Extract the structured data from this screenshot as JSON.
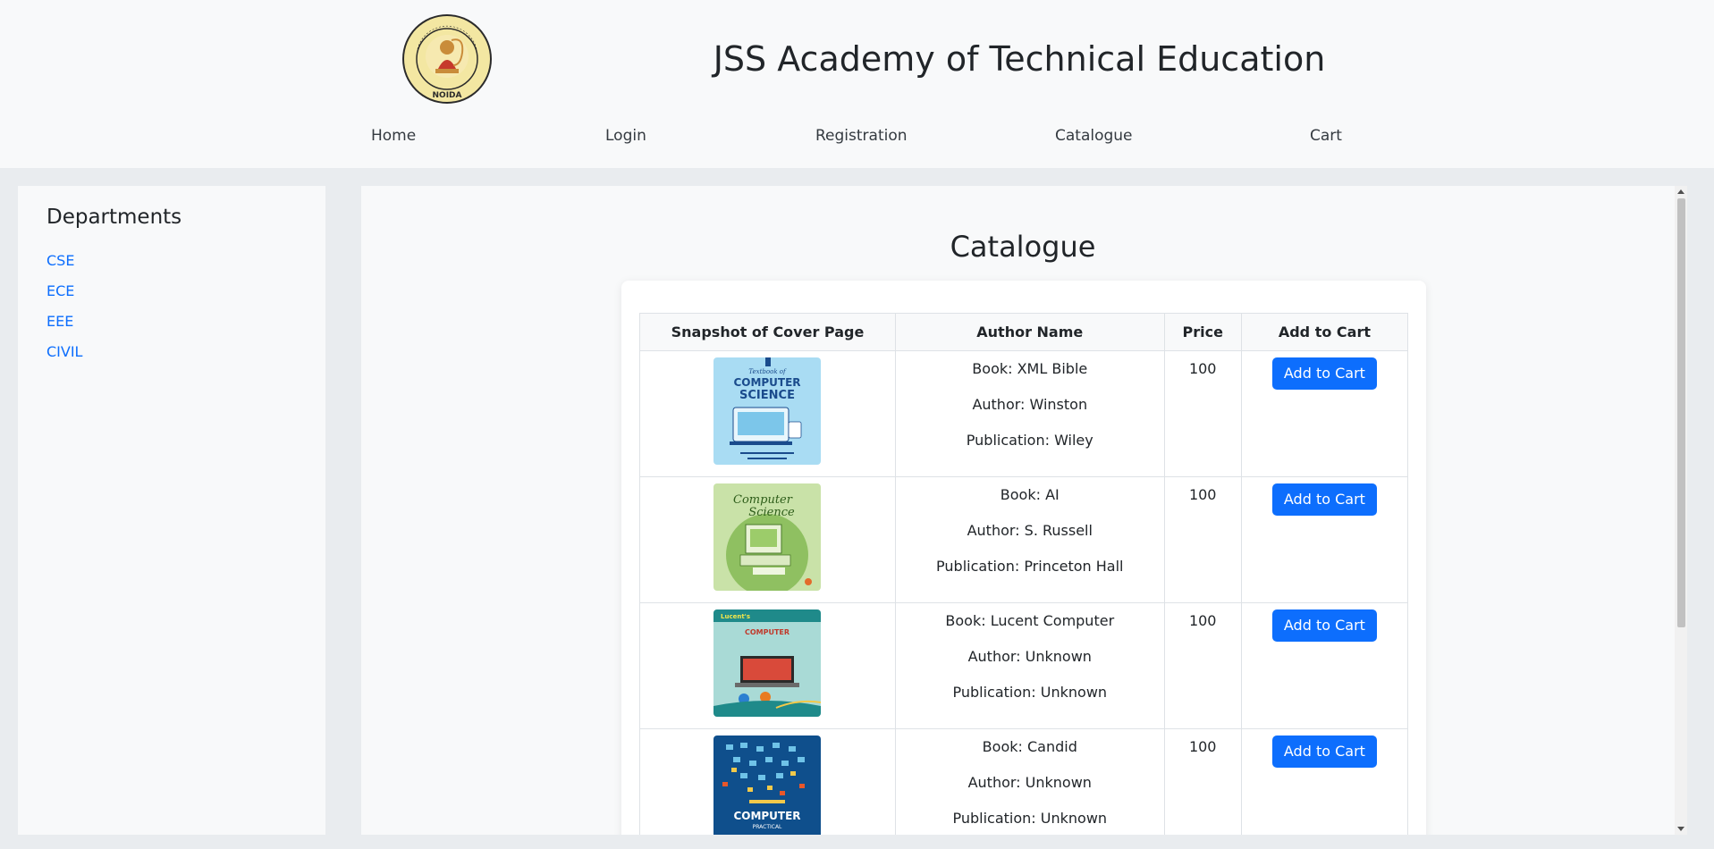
{
  "header": {
    "site_title": "JSS Academy of Technical Education",
    "logo_text": "NOIDA"
  },
  "nav": {
    "items": [
      {
        "label": "Home"
      },
      {
        "label": "Login"
      },
      {
        "label": "Registration"
      },
      {
        "label": "Catalogue"
      },
      {
        "label": "Cart"
      }
    ]
  },
  "sidebar": {
    "title": "Departments",
    "links": [
      {
        "label": "CSE"
      },
      {
        "label": "ECE"
      },
      {
        "label": "EEE"
      },
      {
        "label": "CIVIL"
      }
    ]
  },
  "catalogue": {
    "title": "Catalogue",
    "columns": [
      "Snapshot of Cover Page",
      "Author Name",
      "Price",
      "Add to Cart"
    ],
    "books": [
      {
        "book": "Book: XML Bible",
        "author": "Author: Winston",
        "publication": "Publication: Wiley",
        "price": "100",
        "button": "Add to Cart",
        "cover_color": "#a9dcf3",
        "cover_text": "COMPUTER SCIENCE"
      },
      {
        "book": "Book: AI",
        "author": "Author: S. Russell",
        "publication": "Publication: Princeton Hall",
        "price": "100",
        "button": "Add to Cart",
        "cover_color": "#a6cf7d",
        "cover_text": "Computer Science"
      },
      {
        "book": "Book: Lucent Computer",
        "author": "Author: Unknown",
        "publication": "Publication: Unknown",
        "price": "100",
        "button": "Add to Cart",
        "cover_color": "#1f8a8a",
        "cover_text": "COMPUTER"
      },
      {
        "book": "Book: Candid",
        "author": "Author: Unknown",
        "publication": "Publication: Unknown",
        "price": "100",
        "button": "Add to Cart",
        "cover_color": "#0f4f8c",
        "cover_text": "COMPUTER"
      }
    ]
  },
  "colors": {
    "primary": "#0d6efd",
    "link": "#0d6efd",
    "background": "#e9ecef",
    "panel": "#f8f9fa"
  }
}
